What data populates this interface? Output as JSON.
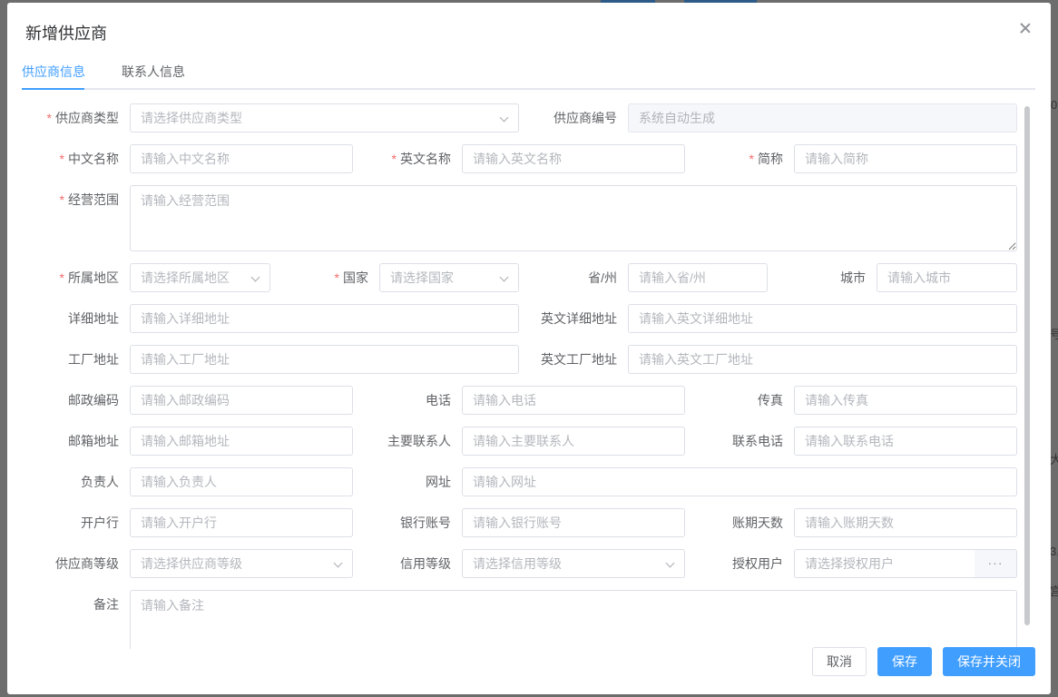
{
  "background": {
    "snippets": [
      "0",
      "号",
      "3.",
      "宫",
      "大"
    ]
  },
  "dialog": {
    "title": "新增供应商",
    "tabs": [
      {
        "label": "供应商信息",
        "active": true
      },
      {
        "label": "联系人信息",
        "active": false
      }
    ]
  },
  "form": {
    "supplier_type": {
      "label": "供应商类型",
      "required": true,
      "placeholder": "请选择供应商类型"
    },
    "supplier_code": {
      "label": "供应商编号",
      "placeholder": "系统自动生成",
      "disabled": true
    },
    "cn_name": {
      "label": "中文名称",
      "required": true,
      "placeholder": "请输入中文名称"
    },
    "en_name": {
      "label": "英文名称",
      "required": true,
      "placeholder": "请输入英文名称"
    },
    "short_name": {
      "label": "简称",
      "required": true,
      "placeholder": "请输入简称"
    },
    "business_scope": {
      "label": "经营范围",
      "required": true,
      "placeholder": "请输入经营范围"
    },
    "region": {
      "label": "所属地区",
      "required": true,
      "placeholder": "请选择所属地区"
    },
    "country": {
      "label": "国家",
      "required": true,
      "placeholder": "请选择国家"
    },
    "province": {
      "label": "省/州",
      "placeholder": "请输入省/州"
    },
    "city": {
      "label": "城市",
      "placeholder": "请输入城市"
    },
    "address": {
      "label": "详细地址",
      "placeholder": "请输入详细地址"
    },
    "en_address": {
      "label": "英文详细地址",
      "placeholder": "请输入英文详细地址"
    },
    "factory_address": {
      "label": "工厂地址",
      "placeholder": "请输入工厂地址"
    },
    "en_factory_address": {
      "label": "英文工厂地址",
      "placeholder": "请输入英文工厂地址"
    },
    "postal_code": {
      "label": "邮政编码",
      "placeholder": "请输入邮政编码"
    },
    "phone": {
      "label": "电话",
      "placeholder": "请输入电话"
    },
    "fax": {
      "label": "传真",
      "placeholder": "请输入传真"
    },
    "email": {
      "label": "邮箱地址",
      "placeholder": "请输入邮箱地址"
    },
    "main_contact": {
      "label": "主要联系人",
      "placeholder": "请输入主要联系人"
    },
    "contact_phone": {
      "label": "联系电话",
      "placeholder": "请输入联系电话"
    },
    "person_in_charge": {
      "label": "负责人",
      "placeholder": "请输入负责人"
    },
    "website": {
      "label": "网址",
      "placeholder": "请输入网址"
    },
    "bank": {
      "label": "开户行",
      "placeholder": "请输入开户行"
    },
    "bank_account": {
      "label": "银行账号",
      "placeholder": "请输入银行账号"
    },
    "payment_days": {
      "label": "账期天数",
      "placeholder": "请输入账期天数"
    },
    "supplier_level": {
      "label": "供应商等级",
      "placeholder": "请选择供应商等级"
    },
    "credit_level": {
      "label": "信用等级",
      "placeholder": "请选择信用等级"
    },
    "authorized_user": {
      "label": "授权用户",
      "placeholder": "请选择授权用户",
      "picker_label": "···"
    },
    "remark": {
      "label": "备注",
      "placeholder": "请输入备注"
    }
  },
  "footer": {
    "cancel_label": "取消",
    "save_label": "保存",
    "save_close_label": "保存并关闭"
  },
  "colors": {
    "primary": "#409eff",
    "required": "#f56c6c",
    "border": "#dcdfe6"
  }
}
